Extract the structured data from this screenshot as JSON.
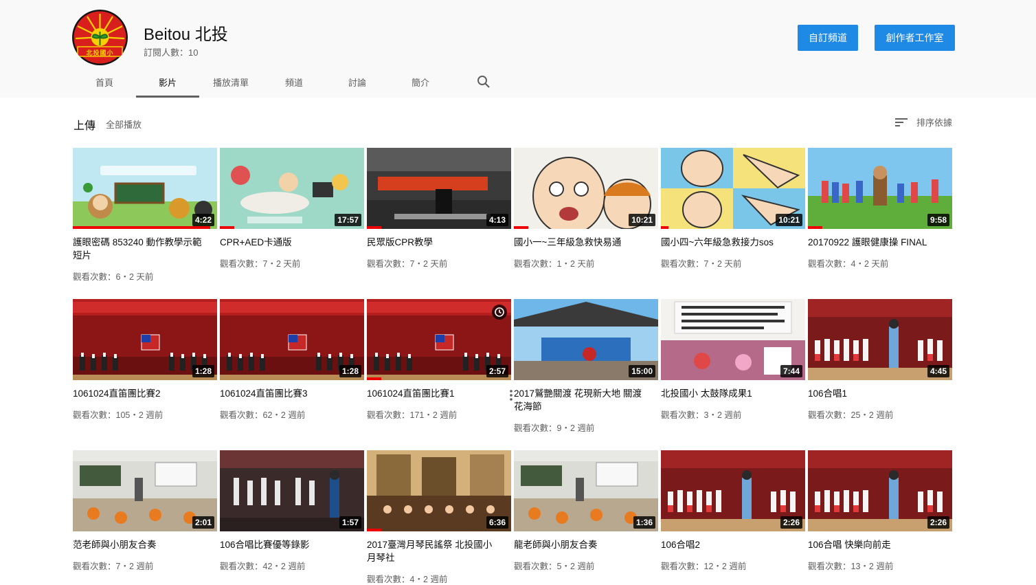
{
  "channel": {
    "name": "Beitou 北投",
    "subscribers": "訂閱人數：10",
    "avatar_text": "北投國小",
    "subscribe_label": "自訂頻道",
    "studio_label": "創作者工作室"
  },
  "tabs": [
    {
      "label": "首頁",
      "active": false
    },
    {
      "label": "影片",
      "active": true
    },
    {
      "label": "播放清單",
      "active": false
    },
    {
      "label": "頻道",
      "active": false
    },
    {
      "label": "討論",
      "active": false
    },
    {
      "label": "簡介",
      "active": false
    }
  ],
  "section": {
    "title": "上傳",
    "play_all": "全部播放",
    "sort_label": "排序依據"
  },
  "videos": [
    {
      "title": "護眼密碼 853240 動作教學示範短片",
      "meta": "觀看次數：6・2 天前",
      "duration": "4:22",
      "progress": 0.95,
      "theme": "cartoon-green"
    },
    {
      "title": "CPR+AED卡通版",
      "meta": "觀看次數：7・2 天前",
      "duration": "17:57",
      "progress": 0.1,
      "theme": "cartoon-teal"
    },
    {
      "title": "民眾版CPR教學",
      "meta": "觀看次數：7・2 天前",
      "duration": "4:13",
      "progress": 0.1,
      "theme": "indoor-dark"
    },
    {
      "title": "國小一~三年級急救快易通",
      "meta": "觀看次數：1・2 天前",
      "duration": "10:21",
      "progress": 0.1,
      "theme": "cartoon-face"
    },
    {
      "title": "國小四~六年級急救接力sos",
      "meta": "觀看次數：7・2 天前",
      "duration": "10:21",
      "progress": 0.05,
      "theme": "cartoon-beach"
    },
    {
      "title": "20170922 護眼健康操 FINAL",
      "meta": "觀看次數：4・2 天前",
      "duration": "9:58",
      "progress": 0.1,
      "theme": "field-kids"
    },
    {
      "title": "1061024直笛團比賽2",
      "meta": "觀看次數：105・2 週前",
      "duration": "1:28",
      "progress": 0,
      "theme": "stage-red"
    },
    {
      "title": "1061024直笛團比賽3",
      "meta": "觀看次數：62・2 週前",
      "duration": "1:28",
      "progress": 0,
      "theme": "stage-red"
    },
    {
      "title": "1061024直笛團比賽1",
      "meta": "觀看次數：171・2 週前",
      "duration": "2:57",
      "progress": 0.1,
      "theme": "stage-red",
      "clock": true,
      "menu": true
    },
    {
      "title": "2017鷲艷關渡 花現新大地 關渡花海節",
      "meta": "觀看次數：9・2 週前",
      "duration": "15:00",
      "progress": 0,
      "theme": "outdoor-tent"
    },
    {
      "title": "北投國小 太鼓隊成果1",
      "meta": "觀看次數：3・2 週前",
      "duration": "7:44",
      "progress": 0,
      "theme": "poster-stage"
    },
    {
      "title": "106合唱1",
      "meta": "觀看次數：25・2 週前",
      "duration": "4:45",
      "progress": 0,
      "theme": "choir"
    },
    {
      "title": "范老師與小朋友合奏",
      "meta": "觀看次數：7・2 週前",
      "duration": "2:01",
      "progress": 0,
      "theme": "classroom"
    },
    {
      "title": "106合唱比賽優等錄影",
      "meta": "觀看次數：42・2 週前",
      "duration": "1:57",
      "progress": 0,
      "theme": "choir-dark"
    },
    {
      "title": "2017臺灣月琴民謠祭 北投國小月琴社",
      "meta": "觀看次數：4・2 週前",
      "duration": "6:36",
      "progress": 0.1,
      "theme": "museum"
    },
    {
      "title": "龍老師與小朋友合奏",
      "meta": "觀看次數：5・2 週前",
      "duration": "1:36",
      "progress": 0,
      "theme": "classroom"
    },
    {
      "title": "106合唱2",
      "meta": "觀看次數：12・2 週前",
      "duration": "2:26",
      "progress": 0,
      "theme": "choir"
    },
    {
      "title": "106合唱 快樂向前走",
      "meta": "觀看次數：13・2 週前",
      "duration": "2:26",
      "progress": 0,
      "theme": "choir"
    }
  ],
  "colors": {
    "accent": "#1f8ae6",
    "progress": "#ee0000",
    "header_bg": "#f9f9f9"
  }
}
